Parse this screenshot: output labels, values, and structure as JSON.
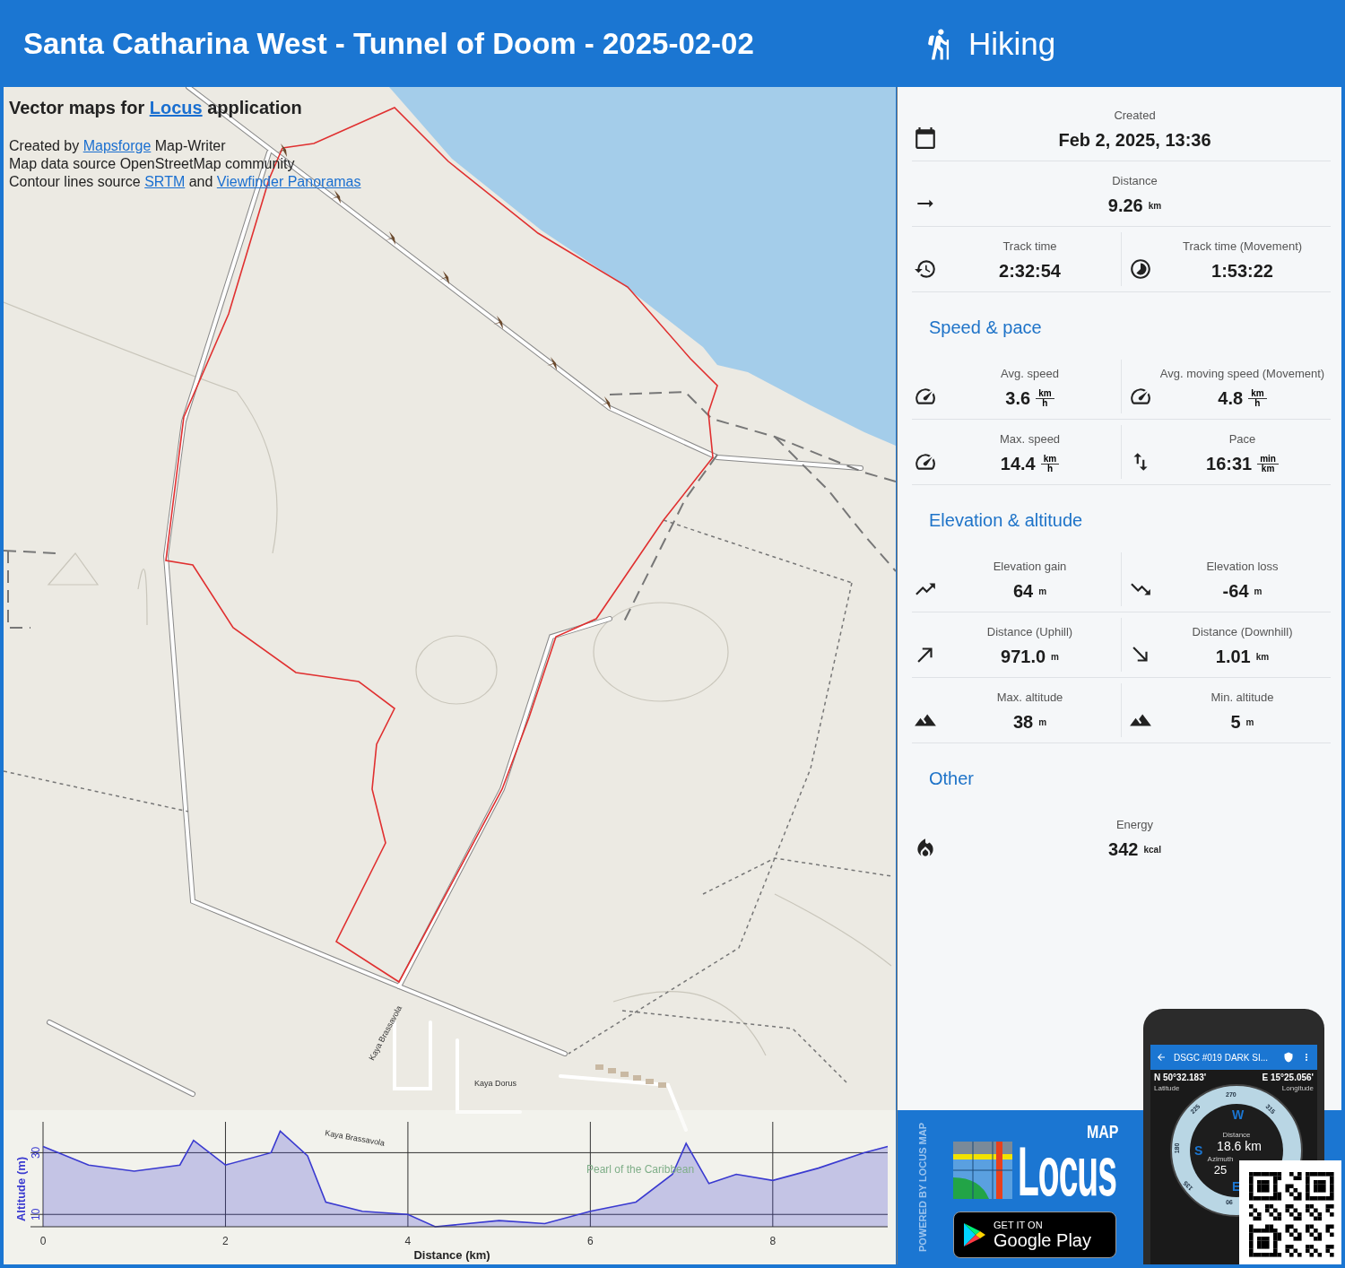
{
  "header": {
    "title": "Santa Catharina West - Tunnel of Doom - 2025-02-02",
    "activity": "Hiking"
  },
  "map": {
    "attribution": [
      {
        "kind": "title",
        "parts": [
          {
            "text": "Vector maps for "
          },
          {
            "text": "Locus",
            "link": true
          },
          {
            "text": " application"
          }
        ]
      },
      {
        "kind": "line",
        "parts": [
          {
            "text": "Created by "
          },
          {
            "text": "Mapsforge",
            "link": true
          },
          {
            "text": " Map-Writer"
          }
        ]
      },
      {
        "kind": "line",
        "parts": [
          {
            "text": "Map data source OpenStreetMap community"
          }
        ]
      },
      {
        "kind": "line",
        "parts": [
          {
            "text": "Contour lines source "
          },
          {
            "text": "SRTM",
            "link": true
          },
          {
            "text": " and "
          },
          {
            "text": "Viewfinder Panoramas",
            "link": true
          }
        ]
      }
    ],
    "labels": [
      {
        "text": "Kaya Brassavola",
        "kind": "street"
      },
      {
        "text": "Kaya Dorus",
        "kind": "street"
      },
      {
        "text": "Kaya Brassavola",
        "kind": "street"
      },
      {
        "text": "Pearl of the Caribbean",
        "kind": "place"
      }
    ]
  },
  "elevation": {
    "chart_data": {
      "type": "area",
      "xlabel": "Distance (km)",
      "ylabel": "Altitude (m)",
      "x": [
        0,
        0.5,
        1,
        1.5,
        1.65,
        2,
        2.5,
        2.6,
        2.9,
        3.1,
        3.5,
        4,
        4.3,
        5,
        5.5,
        6,
        6.5,
        6.9,
        7.05,
        7.3,
        7.6,
        8,
        8.5,
        9,
        9.26
      ],
      "series": [
        {
          "color": "#3a3ad0",
          "values": [
            32,
            26,
            24,
            26,
            34,
            26,
            30,
            37,
            29,
            14,
            11,
            10,
            6,
            8,
            7,
            11,
            14,
            23,
            33,
            20,
            23,
            21,
            25,
            30,
            32
          ]
        }
      ],
      "xlim": [
        0,
        9.26
      ],
      "ylim": [
        6,
        40
      ],
      "xticks": [
        0,
        2,
        4,
        6,
        8
      ],
      "yticks": [
        10,
        30
      ],
      "grid": true
    }
  },
  "stats": [
    {
      "rows": [
        [
          {
            "kind": "date",
            "label": "Created",
            "value": "Feb 2, 2025, 13:36"
          }
        ],
        [
          {
            "kind": "distance",
            "label": "Distance",
            "value": "9.26",
            "unit": "km"
          }
        ],
        [
          {
            "kind": "time",
            "label": "Track time",
            "value": "2:32:54"
          },
          {
            "kind": "movingtime",
            "label": "Track time (Movement)",
            "value": "1:53:22"
          }
        ]
      ]
    },
    {
      "title": "Speed & pace",
      "rows": [
        [
          {
            "kind": "avgspeed",
            "label": "Avg. speed",
            "value": "3.6",
            "unit": "km",
            "unit_denominator": "h"
          },
          {
            "kind": "movingspeed",
            "label": "Avg. moving speed (Movement)",
            "value": "4.8",
            "unit": "km",
            "unit_denominator": "h"
          }
        ],
        [
          {
            "kind": "maxspeed",
            "label": "Max. speed",
            "value": "14.4",
            "unit": "km",
            "unit_denominator": "h"
          },
          {
            "kind": "pace",
            "label": "Pace",
            "value": "16:31",
            "unit": "min",
            "unit_denominator": "km"
          }
        ]
      ]
    },
    {
      "title": "Elevation & altitude",
      "rows": [
        [
          {
            "kind": "gain",
            "label": "Elevation gain",
            "value": "64",
            "unit": "m"
          },
          {
            "kind": "loss",
            "label": "Elevation loss",
            "value": "-64",
            "unit": "m"
          }
        ],
        [
          {
            "kind": "uphill",
            "label": "Distance (Uphill)",
            "value": "971.0",
            "unit": "m"
          },
          {
            "kind": "downhill",
            "label": "Distance (Downhill)",
            "value": "1.01",
            "unit": "km"
          }
        ],
        [
          {
            "kind": "maxalt",
            "label": "Max. altitude",
            "value": "38",
            "unit": "m"
          },
          {
            "kind": "minalt",
            "label": "Min. altitude",
            "value": "5",
            "unit": "m"
          }
        ]
      ]
    },
    {
      "title": "Other",
      "rows": [
        [
          {
            "kind": "energy",
            "label": "Energy",
            "value": "342",
            "unit": "kcal"
          }
        ]
      ]
    }
  ],
  "promo": {
    "powered_by": "POWERED BY LOCUS MAP",
    "logo_word": "Locus",
    "logo_tag": "MAP",
    "store_line1": "GET IT ON",
    "store_line2": "Google Play",
    "phone": {
      "title": "DSGC #019 DARK SI...",
      "lat": "N 50°32.183'",
      "lat_label": "Latitude",
      "lon": "E 15°25.056'",
      "lon_label": "Longitude",
      "dial": [
        "270",
        "225",
        "315",
        "180",
        "135",
        "90"
      ],
      "dial_letters": [
        "W",
        "S",
        "E"
      ],
      "distance_label": "Distance",
      "distance": "18.6 km",
      "azimuth_label": "Azimuth",
      "azimuth": "25"
    }
  }
}
